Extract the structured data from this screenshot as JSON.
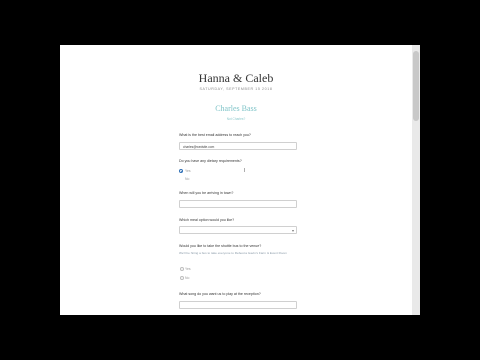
{
  "header": {
    "title": "Hanna & Caleb",
    "date": "SATURDAY, SEPTEMBER 15 2018",
    "guest_name": "Charles Bass",
    "not_you": "Not Charles?"
  },
  "form": {
    "email_question": "What is the best email address to reach you?",
    "email_value": "charles@wedsite.com",
    "dietary_question": "Do you have any dietary requirements?",
    "dietary_options": [
      "Yes",
      "No"
    ],
    "arriving_question": "When will you be arriving in town?",
    "meal_question": "Which meal option would you like?",
    "meal_chevron": "▾",
    "shuttle_question": "Would you like to take the shuttle bus to the venue?",
    "shuttle_help": "We'll be hiring a bus to take everyone to Rebecca Gavin's Farm & Event Room",
    "shuttle_options": [
      "Yes",
      "No"
    ],
    "song_question": "What song do you want us to play at the reception?"
  }
}
